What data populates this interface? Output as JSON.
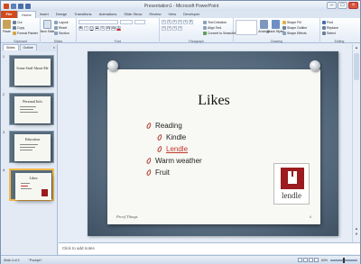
{
  "window": {
    "title": "Presentation1 - Microsoft PowerPoint",
    "controls": [
      "–",
      "□",
      "×"
    ]
  },
  "tabs": {
    "file": "File",
    "items": [
      "Home",
      "Insert",
      "Design",
      "Transitions",
      "Animations",
      "Slide Show",
      "Review",
      "View",
      "Developer"
    ],
    "active": "Home"
  },
  "ribbon": {
    "clipboard": {
      "name": "Clipboard",
      "paste": "Paste",
      "cut": "Cut",
      "copy": "Copy",
      "format_painter": "Format Painter"
    },
    "slides": {
      "name": "Slides",
      "new_slide": "New Slide",
      "layout": "Layout",
      "reset": "Reset",
      "section": "Section"
    },
    "font": {
      "name": "Font"
    },
    "paragraph": {
      "name": "Paragraph",
      "text_direction": "Text Direction",
      "align_text": "Align Text",
      "convert_smartart": "Convert to SmartArt"
    },
    "drawing": {
      "name": "Drawing",
      "arrange": "Arrange",
      "quick_styles": "Quick Styles",
      "shape_fill": "Shape Fill",
      "shape_outline": "Shape Outline",
      "shape_effects": "Shape Effects"
    },
    "editing": {
      "name": "Editing",
      "find": "Find",
      "replace": "Replace",
      "select": "Select"
    }
  },
  "left_pane": {
    "tabs": [
      "Slides",
      "Outline"
    ],
    "close": "×",
    "thumbnails": [
      {
        "number": "1",
        "title": "Some Stuff About Me"
      },
      {
        "number": "2",
        "title": "Personal Info"
      },
      {
        "number": "3",
        "title": "Education"
      },
      {
        "number": "4",
        "title": "Likes"
      }
    ]
  },
  "slide": {
    "title": "Likes",
    "bullets": [
      {
        "text": "Reading",
        "level": 1
      },
      {
        "text": "Kindle",
        "level": 2
      },
      {
        "text": "Lendle",
        "level": 2,
        "link": true
      },
      {
        "text": "Warm weather",
        "level": 1
      },
      {
        "text": "Fruit",
        "level": 1
      }
    ],
    "logo_word": "lendle",
    "signature": "Proof Things",
    "number": "4"
  },
  "notes": {
    "placeholder": "Click to add notes"
  },
  "status": {
    "slide_info": "Slide 4 of 4",
    "theme": "\"Pushpin\"",
    "zoom": "63%"
  },
  "colors": {
    "file_tab": "#d24a1c",
    "bullet_mark": "#b03a2e",
    "link": "#c0392b",
    "selection": "#f4b94a",
    "logo_red": "#9b1b1e"
  }
}
